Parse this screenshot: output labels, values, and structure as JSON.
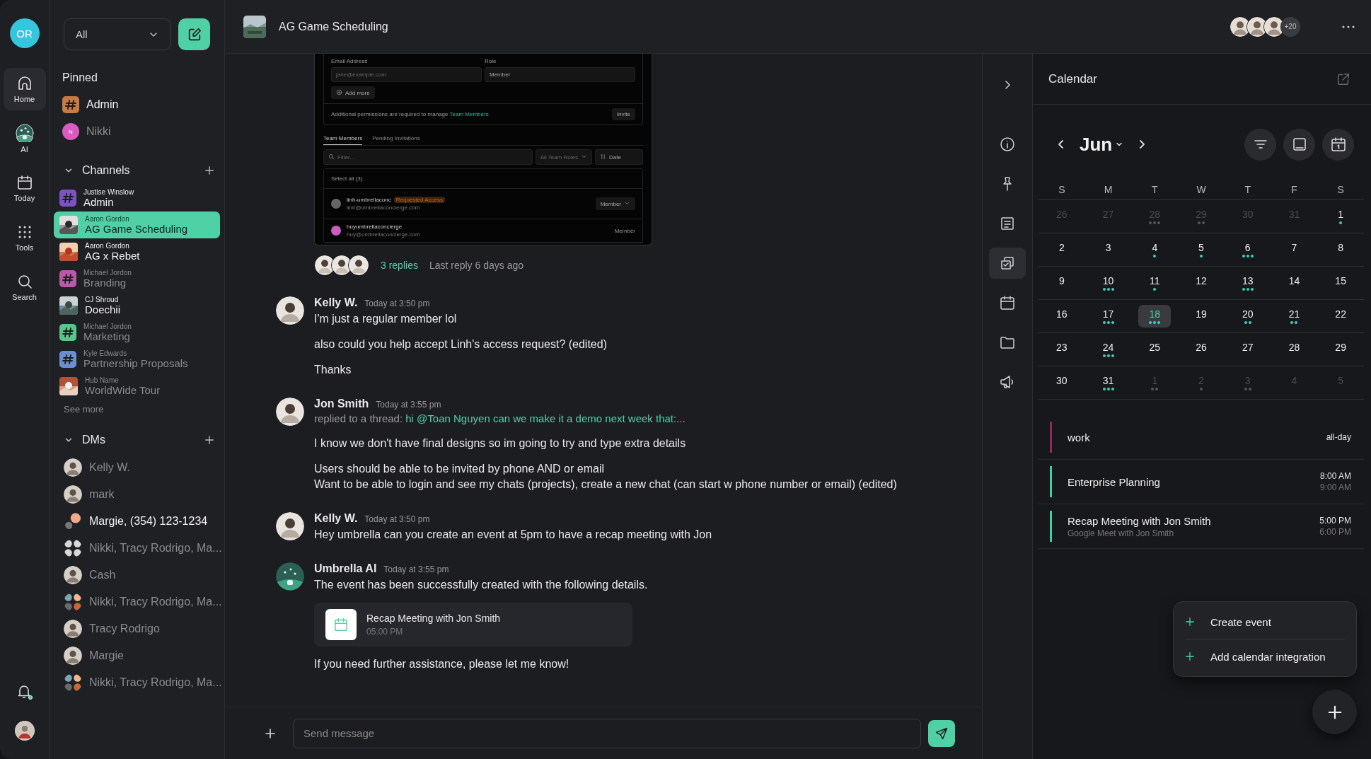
{
  "rail": {
    "workspace": "OR",
    "nav": [
      {
        "label": "Home",
        "kind": "home",
        "selected": true
      },
      {
        "label": "AI",
        "kind": "ai",
        "selected": false
      },
      {
        "label": "Today",
        "kind": "today",
        "selected": false
      },
      {
        "label": "Tools",
        "kind": "tools",
        "selected": false
      },
      {
        "label": "Search",
        "kind": "search",
        "selected": false
      }
    ],
    "notifications_unread": true
  },
  "sidebar": {
    "filter": "All",
    "pinned_title": "Pinned",
    "pinned": [
      {
        "name": "Admin",
        "kind": "hash",
        "color": "#c77a45",
        "unread": true
      },
      {
        "name": "Nikki",
        "kind": "initial",
        "initial": "N",
        "color": "#d95bc0",
        "unread": false
      }
    ],
    "channels_title": "Channels",
    "channels": [
      {
        "owner": "Justise Winslow",
        "name": "Admin",
        "kind": "hash",
        "color": "#7c52c6",
        "unread": true,
        "selected": false
      },
      {
        "owner": "Aaron Gordon",
        "name": "AG Game Scheduling",
        "kind": "picture",
        "unread": true,
        "selected": true
      },
      {
        "owner": "Aaron Gordon",
        "name": "AG x Rebet",
        "kind": "picture",
        "unread": true,
        "selected": false
      },
      {
        "owner": "Michael Jordon",
        "name": "Branding",
        "kind": "hash",
        "color": "#b95aa8",
        "unread": false,
        "selected": false
      },
      {
        "owner": "CJ Shroud",
        "name": "Doechii",
        "kind": "picture",
        "unread": true,
        "selected": false
      },
      {
        "owner": "Michael Jordon",
        "name": "Marketing",
        "kind": "hash",
        "color": "#5cc48a",
        "unread": false,
        "selected": false
      },
      {
        "owner": "Kyle Edwards",
        "name": "Partnership Proposals",
        "kind": "hash",
        "color": "#6b8fcf",
        "unread": false,
        "selected": false
      },
      {
        "owner": "Hub Name",
        "name": "WorldWide Tour",
        "kind": "picture",
        "unread": false,
        "selected": false
      }
    ],
    "see_more": "See more",
    "dms_title": "DMs",
    "dms": [
      {
        "name": "Kelly W.",
        "kind": "person",
        "unread": false
      },
      {
        "name": "mark",
        "kind": "person",
        "unread": false
      },
      {
        "name": "Margie, (354) 123-1234",
        "kind": "pair",
        "unread": true
      },
      {
        "name": "Nikki, Tracy Rodrigo, Ma...",
        "kind": "group",
        "unread": false
      },
      {
        "name": "Cash",
        "kind": "person",
        "unread": false
      },
      {
        "name": "Nikki, Tracy Rodrigo, Ma...",
        "kind": "group-color",
        "unread": false
      },
      {
        "name": "Tracy Rodrigo",
        "kind": "person",
        "unread": false
      },
      {
        "name": "Margie",
        "kind": "person",
        "unread": false
      },
      {
        "name": "Nikki, Tracy Rodrigo, Ma...",
        "kind": "group-color",
        "unread": false
      }
    ]
  },
  "header": {
    "title": "AG Game Scheduling",
    "members": [
      {
        "kind": "person"
      },
      {
        "kind": "person"
      },
      {
        "kind": "person"
      }
    ],
    "more_members": "+20"
  },
  "thread": {
    "screenshot": {
      "email_label": "Email Address",
      "email_placeholder": "jane@example.com",
      "role_label": "Role",
      "role_value": "Member",
      "add_more": "Add more",
      "permissions_text": "Additional permissions are required to manage",
      "permissions_link": "Team Members",
      "invite": "Invite",
      "tabs": [
        {
          "label": "Team Members",
          "selected": true
        },
        {
          "label": "Pending Invitations",
          "selected": false
        }
      ],
      "filter_placeholder": "Filter...",
      "roles_filter": "All Team Roles",
      "sort": "Date",
      "select_all": "Select all (3)",
      "members": [
        {
          "name": "linh-umbrellaconc",
          "badge": "Requested Access",
          "email": "linh@umbrellaconcierge.com",
          "role": "Member",
          "kind": "dropdown"
        },
        {
          "name": "huyumbrellaconcierge",
          "email": "huy@umbrellaconcierge.com",
          "role": "Member",
          "kind": "text"
        }
      ]
    },
    "avatars": [
      {
        "kind": "person"
      },
      {
        "kind": "person"
      },
      {
        "kind": "person"
      }
    ],
    "replies": "3 replies",
    "last_reply": "Last reply 6 days ago"
  },
  "messages": [
    {
      "author": "Kelly W.",
      "time": "Today at 3:50 pm",
      "kind": "person",
      "paragraphs": [
        [
          "I'm just a regular member lol"
        ],
        [
          "also could you help accept Linh's access request? (edited)"
        ],
        [
          "Thanks"
        ]
      ]
    },
    {
      "author": "Jon Smith",
      "time": "Today at 3:55 pm",
      "kind": "person",
      "reply_to": {
        "label": "replied to a thread:",
        "text": "hi @Toan Nguyen can we make it a demo next week that:..."
      },
      "paragraphs": [
        [
          "I know we don't have final designs so im going to try and type extra details"
        ],
        [
          " Users should be able to be invited by phone AND or email",
          "Want to be able to login and see my chats (projects), create a new chat (can start w phone number or email)  (edited)"
        ]
      ]
    },
    {
      "author": "Kelly W.",
      "time": "Today at 3:50 pm",
      "kind": "person",
      "paragraphs": [
        [
          "Hey umbrella can you create an event at 5pm to have a recap meeting with Jon"
        ]
      ]
    },
    {
      "author": "Umbrella AI",
      "time": "Today at 3:55 pm",
      "kind": "bot",
      "paragraphs": [
        [
          "The event has been successfully created with the following details."
        ]
      ],
      "event": {
        "title": "Recap Meeting with Jon Smith",
        "time": "05:00 PM"
      },
      "closing": "If you need further assistance, please let me know!"
    }
  ],
  "composer": {
    "placeholder": "Send message"
  },
  "tool_rail": [
    {
      "kind": "expand",
      "selected": false
    },
    {
      "kind": "info",
      "selected": false
    },
    {
      "kind": "pin",
      "selected": false
    },
    {
      "kind": "notes",
      "selected": false
    },
    {
      "kind": "tasks",
      "selected": true
    },
    {
      "kind": "calendar",
      "selected": false
    },
    {
      "kind": "folder",
      "selected": false
    },
    {
      "kind": "megaphone",
      "selected": false
    }
  ],
  "calendar": {
    "title": "Calendar",
    "month": "Jun",
    "weekdays": [
      "S",
      "M",
      "T",
      "W",
      "T",
      "F",
      "S"
    ],
    "weeks": [
      [
        {
          "day": "26",
          "muted": true,
          "selected": false
        },
        {
          "day": "27",
          "muted": true,
          "selected": false
        },
        {
          "day": "28",
          "muted": true,
          "selected": false,
          "dots": [
            {
              "kind": "event"
            },
            {
              "kind": "event"
            },
            {
              "kind": "event"
            }
          ]
        },
        {
          "day": "29",
          "muted": true,
          "selected": false,
          "dots": [
            {
              "kind": "event"
            },
            {
              "kind": "event"
            }
          ]
        },
        {
          "day": "30",
          "muted": true,
          "selected": false
        },
        {
          "day": "31",
          "muted": true,
          "selected": false
        },
        {
          "day": "1",
          "muted": false,
          "selected": false,
          "dots": [
            {
              "kind": "event"
            }
          ]
        }
      ],
      [
        {
          "day": "2",
          "muted": false,
          "selected": false
        },
        {
          "day": "3",
          "muted": false,
          "selected": false
        },
        {
          "day": "4",
          "muted": false,
          "selected": false,
          "dots": [
            {
              "kind": "event"
            }
          ]
        },
        {
          "day": "5",
          "muted": false,
          "selected": false,
          "dots": [
            {
              "kind": "event"
            }
          ]
        },
        {
          "day": "6",
          "muted": false,
          "selected": false,
          "dots": [
            {
              "kind": "event"
            },
            {
              "kind": "event"
            },
            {
              "kind": "event"
            }
          ]
        },
        {
          "day": "7",
          "muted": false,
          "selected": false
        },
        {
          "day": "8",
          "muted": false,
          "selected": false
        }
      ],
      [
        {
          "day": "9",
          "muted": false,
          "selected": false
        },
        {
          "day": "10",
          "muted": false,
          "selected": false,
          "dots": [
            {
              "kind": "event"
            },
            {
              "kind": "event"
            },
            {
              "kind": "event"
            }
          ]
        },
        {
          "day": "11",
          "muted": false,
          "selected": false,
          "dots": [
            {
              "kind": "event"
            }
          ]
        },
        {
          "day": "12",
          "muted": false,
          "selected": false
        },
        {
          "day": "13",
          "muted": false,
          "selected": false,
          "dots": [
            {
              "kind": "event"
            },
            {
              "kind": "event"
            },
            {
              "kind": "event"
            }
          ]
        },
        {
          "day": "14",
          "muted": false,
          "selected": false
        },
        {
          "day": "15",
          "muted": false,
          "selected": false
        }
      ],
      [
        {
          "day": "16",
          "muted": false,
          "selected": false
        },
        {
          "day": "17",
          "muted": false,
          "selected": false,
          "dots": [
            {
              "kind": "event"
            },
            {
              "kind": "event"
            },
            {
              "kind": "event"
            }
          ]
        },
        {
          "day": "18",
          "muted": false,
          "selected": true,
          "dots": [
            {
              "kind": "event"
            },
            {
              "kind": "event"
            },
            {
              "kind": "event"
            }
          ]
        },
        {
          "day": "19",
          "muted": false,
          "selected": false
        },
        {
          "day": "20",
          "muted": false,
          "selected": false,
          "dots": [
            {
              "kind": "event"
            },
            {
              "kind": "event"
            }
          ]
        },
        {
          "day": "21",
          "muted": false,
          "selected": false,
          "dots": [
            {
              "kind": "event"
            },
            {
              "kind": "event"
            }
          ]
        },
        {
          "day": "22",
          "muted": false,
          "selected": false
        }
      ],
      [
        {
          "day": "23",
          "muted": false,
          "selected": false
        },
        {
          "day": "24",
          "muted": false,
          "selected": false,
          "dots": [
            {
              "kind": "event"
            },
            {
              "kind": "event"
            },
            {
              "kind": "event"
            }
          ]
        },
        {
          "day": "25",
          "muted": false,
          "selected": false
        },
        {
          "day": "26",
          "muted": false,
          "selected": false
        },
        {
          "day": "27",
          "muted": false,
          "selected": false
        },
        {
          "day": "28",
          "muted": false,
          "selected": false
        },
        {
          "day": "29",
          "muted": false,
          "selected": false
        }
      ],
      [
        {
          "day": "30",
          "muted": false,
          "selected": false
        },
        {
          "day": "31",
          "muted": false,
          "selected": false,
          "dots": [
            {
              "kind": "event"
            },
            {
              "kind": "event"
            },
            {
              "kind": "event"
            }
          ]
        },
        {
          "day": "1",
          "muted": true,
          "selected": false,
          "dots": [
            {
              "kind": "event"
            },
            {
              "kind": "event"
            }
          ]
        },
        {
          "day": "2",
          "muted": true,
          "selected": false,
          "dots": [
            {
              "kind": "event"
            }
          ]
        },
        {
          "day": "3",
          "muted": true,
          "selected": false,
          "dots": [
            {
              "kind": "event"
            },
            {
              "kind": "event"
            }
          ]
        },
        {
          "day": "4",
          "muted": true,
          "selected": false
        },
        {
          "day": "5",
          "muted": true,
          "selected": false
        }
      ]
    ],
    "events": [
      {
        "title": "work",
        "color": "#8e2a5e",
        "time": "all-day"
      },
      {
        "title": "Enterprise Planning",
        "color": "#3ecfa0",
        "start": "8:00 AM",
        "end": "9:00 AM"
      },
      {
        "title": "Recap Meeting with Jon Smith",
        "subtitle": "Google Meet with Jon Smith",
        "color": "#3ecfa0",
        "start": "5:00 PM",
        "end": "6:00 PM"
      }
    ],
    "menu": [
      "Create event",
      "Add calendar integration"
    ]
  }
}
